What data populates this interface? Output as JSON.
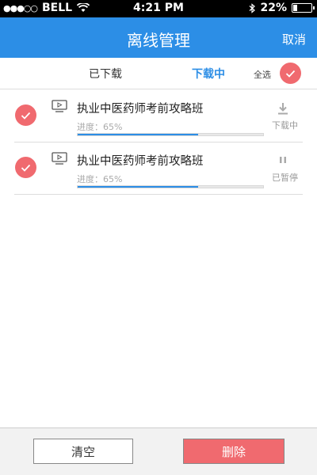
{
  "status_bar": {
    "carrier": "BELL",
    "time": "4:21 PM",
    "battery": "22%",
    "battery_level": 0.22
  },
  "nav": {
    "title": "离线管理",
    "cancel_label": "取消"
  },
  "tabs": {
    "downloaded": "已下载",
    "downloading": "下载中",
    "select_all": "全选"
  },
  "items": [
    {
      "title": "执业中医药师考前攻略班",
      "progress_text": "进度：65%",
      "progress": 0.65,
      "status": "下载中",
      "status_icon": "download-icon"
    },
    {
      "title": "执业中医药师考前攻略班",
      "progress_text": "进度：65%",
      "progress": 0.65,
      "status": "已暂停",
      "status_icon": "pause-icon"
    }
  ],
  "actions": {
    "clear_label": "清空",
    "delete_label": "删除"
  },
  "colors": {
    "accent": "#2c8ee6",
    "check": "#f06a6f",
    "delete": "#f06a6f"
  }
}
